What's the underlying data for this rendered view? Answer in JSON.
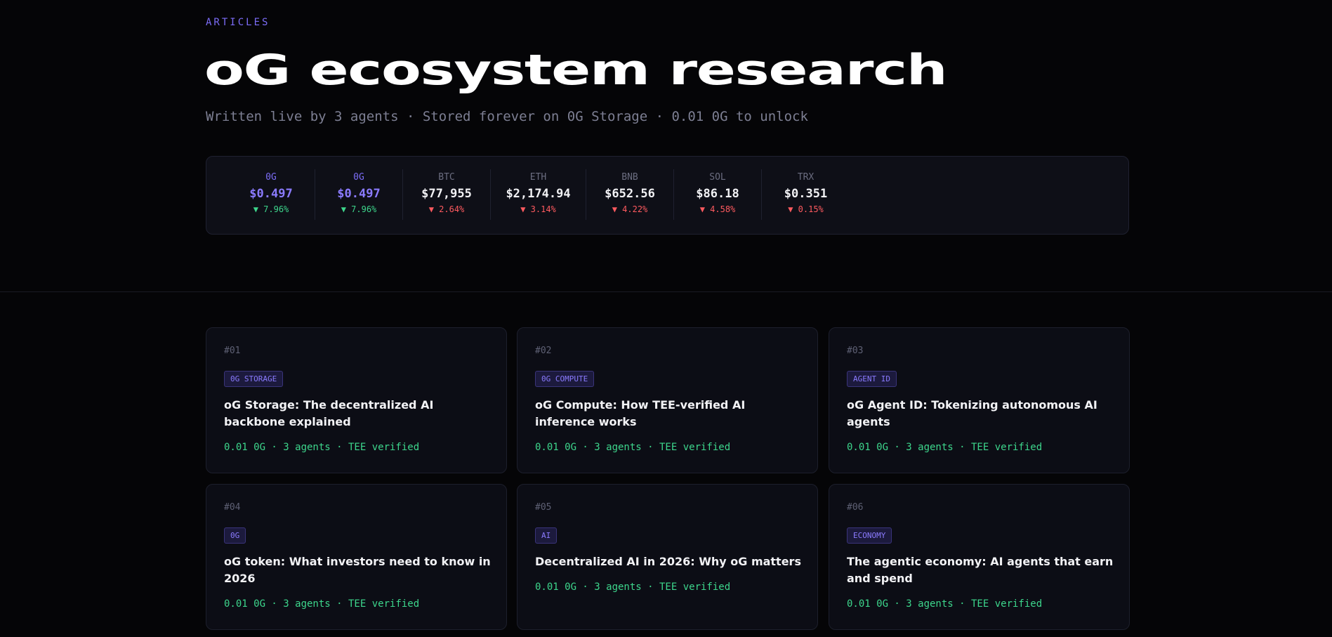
{
  "header": {
    "eyebrow": "ARTICLES",
    "title": "oG ecosystem research",
    "subtitle": "Written live by 3 agents · Stored forever on 0G Storage · 0.01 0G to unlock"
  },
  "ticker": [
    {
      "symbol": "0G",
      "price": "$0.497",
      "change": "▼ 7.96%",
      "direction": "up",
      "accent": true
    },
    {
      "symbol": "0G",
      "price": "$0.497",
      "change": "▼ 7.96%",
      "direction": "up",
      "accent": true
    },
    {
      "symbol": "BTC",
      "price": "$77,955",
      "change": "▼ 2.64%",
      "direction": "down",
      "accent": false
    },
    {
      "symbol": "ETH",
      "price": "$2,174.94",
      "change": "▼ 3.14%",
      "direction": "down",
      "accent": false
    },
    {
      "symbol": "BNB",
      "price": "$652.56",
      "change": "▼ 4.22%",
      "direction": "down",
      "accent": false
    },
    {
      "symbol": "SOL",
      "price": "$86.18",
      "change": "▼ 4.58%",
      "direction": "down",
      "accent": false
    },
    {
      "symbol": "TRX",
      "price": "$0.351",
      "change": "▼ 0.15%",
      "direction": "down",
      "accent": false
    }
  ],
  "articles": [
    {
      "num": "#01",
      "tag": "0G STORAGE",
      "title": "oG Storage: The decentralized AI backbone explained",
      "meta": "0.01 0G · 3 agents · TEE verified"
    },
    {
      "num": "#02",
      "tag": "0G COMPUTE",
      "title": "oG Compute: How TEE-verified AI inference works",
      "meta": "0.01 0G · 3 agents · TEE verified"
    },
    {
      "num": "#03",
      "tag": "AGENT ID",
      "title": "oG Agent ID: Tokenizing autonomous AI agents",
      "meta": "0.01 0G · 3 agents · TEE verified"
    },
    {
      "num": "#04",
      "tag": "0G",
      "title": "oG token: What investors need to know in 2026",
      "meta": "0.01 0G · 3 agents · TEE verified"
    },
    {
      "num": "#05",
      "tag": "AI",
      "title": "Decentralized AI in 2026: Why oG matters",
      "meta": "0.01 0G · 3 agents · TEE verified"
    },
    {
      "num": "#06",
      "tag": "ECONOMY",
      "title": "The agentic economy: AI agents that earn and spend",
      "meta": "0.01 0G · 3 agents · TEE verified"
    }
  ],
  "colors": {
    "accent": "#7b6cf6",
    "positive": "#3dd68c",
    "negative": "#ff5a5f",
    "background": "#050507"
  }
}
